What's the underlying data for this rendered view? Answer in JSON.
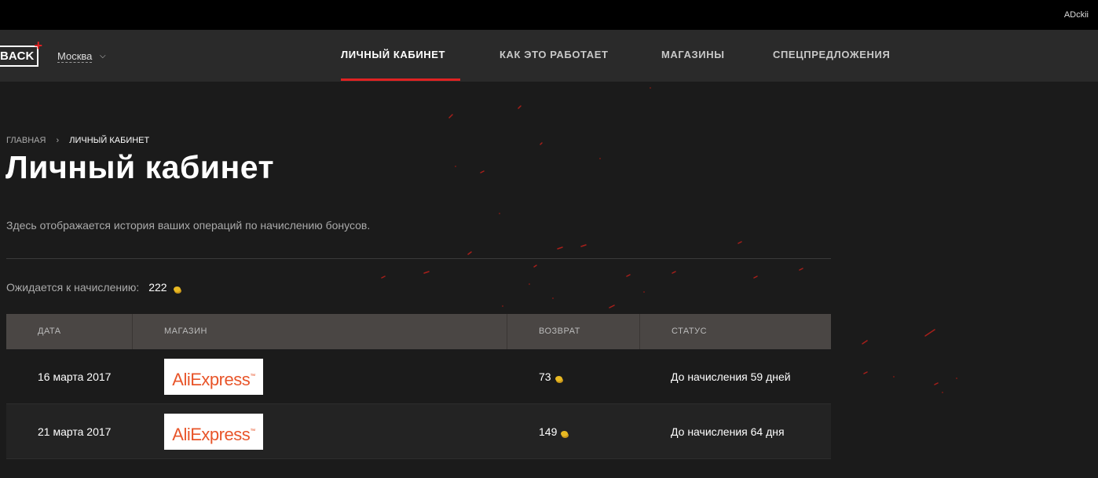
{
  "topbar": {
    "user": "ADckii"
  },
  "header": {
    "logo_text": "BACK",
    "logo_plus": "+",
    "city": "Москва",
    "nav": [
      {
        "label": "ЛИЧНЫЙ КАБИНЕТ",
        "active": true
      },
      {
        "label": "КАК ЭТО РАБОТАЕТ",
        "active": false
      },
      {
        "label": "МАГАЗИНЫ",
        "active": false
      },
      {
        "label": "СПЕЦПРЕДЛОЖЕНИЯ",
        "active": false
      }
    ]
  },
  "breadcrumb": {
    "home": "ГЛАВНАЯ",
    "current": "ЛИЧНЫЙ КАБИНЕТ"
  },
  "page": {
    "title": "Личный кабинет",
    "description": "Здесь отображается история ваших операций по начислению бонусов.",
    "pending_label": "Ожидается к начислению:",
    "pending_amount": "222"
  },
  "table": {
    "headers": [
      "ДАТА",
      "МАГАЗИН",
      "ВОЗВРАТ",
      "СТАТУС"
    ],
    "rows": [
      {
        "date": "16 марта 2017",
        "store": "AliExpress",
        "cashback": "73",
        "status": "До начисления 59 дней"
      },
      {
        "date": "21 марта 2017",
        "store": "AliExpress",
        "cashback": "149",
        "status": "До начисления 64 дня"
      }
    ]
  },
  "colors": {
    "accent": "#e02222",
    "background": "#1b1b1b",
    "header": "#2a2a2a",
    "table_header": "#4a4644"
  }
}
